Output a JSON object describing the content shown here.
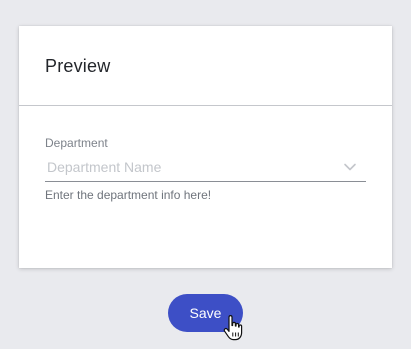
{
  "card": {
    "title": "Preview"
  },
  "field": {
    "label": "Department",
    "placeholder": "Department Name",
    "helper": "Enter the department info here!",
    "dropdown_icon": "chevron-down-icon"
  },
  "actions": {
    "save_label": "Save",
    "save_color": "#3d4fc6"
  },
  "cursor": {
    "icon": "hand-pointer-cursor-icon"
  },
  "colors": {
    "background": "#e9eaee",
    "card": "#ffffff"
  }
}
